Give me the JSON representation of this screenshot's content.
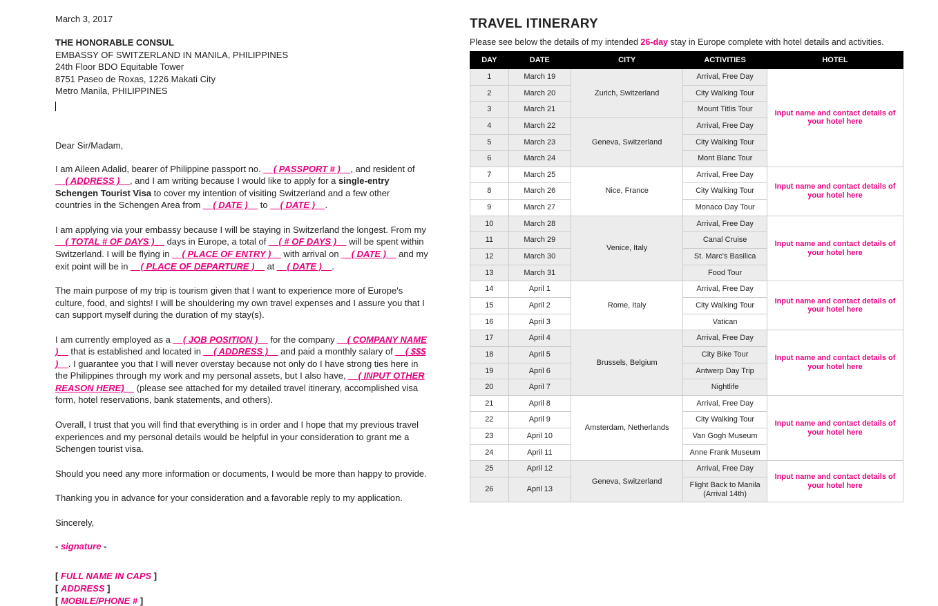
{
  "letter": {
    "date": "March 3, 2017",
    "addressee_title": "THE HONORABLE CONSUL",
    "addr1": "EMBASSY OF SWITZERLAND IN MANILA, PHILIPPINES",
    "addr2": "24th Floor BDO Equitable Tower",
    "addr3": "8751 Paseo de Roxas, 1226 Makati City",
    "addr4": "Metro Manila, PHILIPPINES",
    "salutation": "Dear Sir/Madam,",
    "p1_a": "I am Aileen Adalid, bearer of Philippine passport no. ",
    "ph_passport": "__( PASSPORT # )__",
    "p1_b": ", and resident of ",
    "ph_address1": "__( ADDRESS )__",
    "p1_c": ", and I am writing because I would like to apply for a ",
    "p1_bold": "single-entry Schengen Tourist Visa",
    "p1_d": " to cover my intention of visiting Switzerland and a few other countries in the Schengen Area from ",
    "ph_date1": "__( DATE )__",
    "p1_e": " to ",
    "ph_date2": "__( DATE )__",
    "p1_f": ".",
    "p2_a": "I am applying via your embassy because I will be staying in Switzerland the longest. From my ",
    "ph_totaldays": "__( TOTAL # OF DAYS )__",
    "p2_b": " days in Europe, a total of ",
    "ph_numdays": "__( # OF DAYS )__",
    "p2_c": " will be spent within Switzerland. I will be flying in ",
    "ph_entry": "__( PLACE OF ENTRY )__",
    "p2_d": " with arrival on ",
    "ph_date3": "__( DATE )__",
    "p2_e": " and my exit point will be in ",
    "ph_departure": "__( PLACE OF DEPARTURE )__",
    "p2_f": " at ",
    "ph_date4": "__( DATE )__",
    "p2_g": ".",
    "p3": "The main purpose of my trip is tourism given that I want to experience more of Europe's culture, food, and sights! I will be shouldering my own travel expenses and I assure you that I can support myself during the duration of my stay(s).",
    "p4_a": "I am currently employed as a ",
    "ph_job": "__( JOB POSITION )__",
    "p4_b": " for the company ",
    "ph_company": "__( COMPANY NAME )__",
    "p4_c": " that is established and located in ",
    "ph_address2": "__( ADDRESS )__",
    "p4_d": " and paid a monthly salary of ",
    "ph_salary": "__( $$$ )__",
    "p4_e": ". I guarantee you that I will never overstay because not only do I have strong ties here in the Philippines through my work and my personal assets, but I also have, ",
    "ph_reason": "__( INPUT OTHER REASON HERE)__",
    "p4_f": " (please see attached for my detailed travel itinerary, accomplished visa form, hotel reservations, bank statements, and others).",
    "p5": "Overall, I trust that you will find that everything is in order and I hope that my previous travel experiences and my personal details would be helpful in your consideration to grant me a Schengen tourist visa.",
    "p6": "Should you need any more information or documents, I would be more than happy to provide.",
    "p7": "Thanking you in advance for your consideration and a favorable reply to my application.",
    "closing": "Sincerely,",
    "sigdash1": "- ",
    "signature": "signature",
    "sigdash2": " -",
    "sig_name_l": "[ ",
    "sig_name": "FULL NAME IN CAPS",
    "sig_name_r": " ]",
    "sig_addr_l": "[ ",
    "sig_addr": "ADDRESS",
    "sig_addr_r": " ]",
    "sig_phone_l": "[  ",
    "sig_phone": "MOBILE/PHONE #",
    "sig_phone_r": "  ]"
  },
  "itinerary": {
    "title": "TRAVEL ITINERARY",
    "subtitle_a": "Please see below the details of my intended ",
    "days": "26-day",
    "subtitle_b": " stay in Europe complete with hotel details and activities.",
    "headers": {
      "day": "DAY",
      "date": "DATE",
      "city": "CITY",
      "activities": "ACTIVITIES",
      "hotel": "HOTEL"
    },
    "hotel_ph": "Input name and contact details of your hotel here",
    "groups": [
      {
        "city": "Zurich, Switzerland",
        "shade": true,
        "rows": [
          {
            "day": "1",
            "date": "March 19",
            "act": "Arrival, Free Day"
          },
          {
            "day": "2",
            "date": "March 20",
            "act": "City Walking Tour"
          },
          {
            "day": "3",
            "date": "March 21",
            "act": "Mount Titlis Tour"
          }
        ]
      },
      {
        "city": "Geneva, Switzerland",
        "shade": true,
        "rows": [
          {
            "day": "4",
            "date": "March 22",
            "act": "Arrival, Free Day"
          },
          {
            "day": "5",
            "date": "March 23",
            "act": "City Walking Tour"
          },
          {
            "day": "6",
            "date": "March 24",
            "act": "Mont Blanc Tour"
          }
        ]
      },
      {
        "city": "Nice, France",
        "shade": false,
        "rows": [
          {
            "day": "7",
            "date": "March 25",
            "act": "Arrival, Free Day"
          },
          {
            "day": "8",
            "date": "March 26",
            "act": "City Walking Tour"
          },
          {
            "day": "9",
            "date": "March 27",
            "act": "Monaco Day Tour"
          }
        ]
      },
      {
        "city": "Venice, Italy",
        "shade": true,
        "rows": [
          {
            "day": "10",
            "date": "March 28",
            "act": "Arrival, Free Day"
          },
          {
            "day": "11",
            "date": "March 29",
            "act": "Canal Cruise"
          },
          {
            "day": "12",
            "date": "March 30",
            "act": "St. Marc's Basilica"
          },
          {
            "day": "13",
            "date": "March 31",
            "act": "Food Tour"
          }
        ]
      },
      {
        "city": "Rome, Italy",
        "shade": false,
        "rows": [
          {
            "day": "14",
            "date": "April 1",
            "act": "Arrival, Free Day"
          },
          {
            "day": "15",
            "date": "April 2",
            "act": "City Walking Tour"
          },
          {
            "day": "16",
            "date": "April 3",
            "act": "Vatican"
          }
        ]
      },
      {
        "city": "Brussels, Belgium",
        "shade": true,
        "rows": [
          {
            "day": "17",
            "date": "April 4",
            "act": "Arrival, Free Day"
          },
          {
            "day": "18",
            "date": "April 5",
            "act": "City Bike Tour"
          },
          {
            "day": "19",
            "date": "April 6",
            "act": "Antwerp Day Trip"
          },
          {
            "day": "20",
            "date": "April 7",
            "act": "Nightlife"
          }
        ]
      },
      {
        "city": "Amsterdam, Netherlands",
        "shade": false,
        "rows": [
          {
            "day": "21",
            "date": "April 8",
            "act": "Arrival, Free Day"
          },
          {
            "day": "22",
            "date": "April 9",
            "act": "City Walking Tour"
          },
          {
            "day": "23",
            "date": "April 10",
            "act": "Van Gogh Museum"
          },
          {
            "day": "24",
            "date": "April 11",
            "act": "Anne Frank Museum"
          }
        ]
      },
      {
        "city": "Geneva, Switzerland",
        "shade": true,
        "rows": [
          {
            "day": "25",
            "date": "April 12",
            "act": "Arrival, Free Day"
          },
          {
            "day": "26",
            "date": "April 13",
            "act": "Flight Back to Manila (Arrival 14th)"
          }
        ]
      }
    ]
  }
}
